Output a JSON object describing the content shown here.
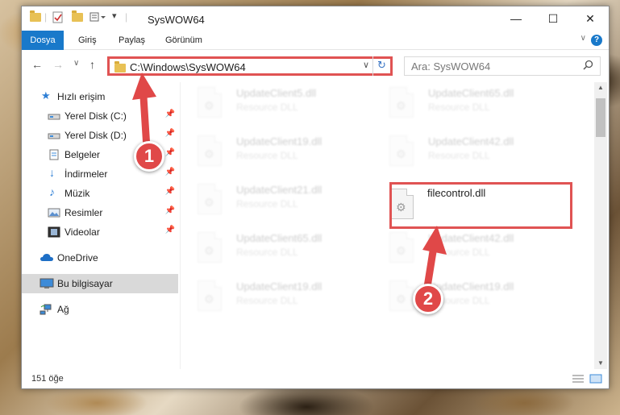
{
  "window": {
    "title": "SysWOW64",
    "minimize": "—",
    "maximize": "☐",
    "close": "✕"
  },
  "ribbon": {
    "tabs": [
      "Dosya",
      "Giriş",
      "Paylaş",
      "Görünüm"
    ],
    "help": "?"
  },
  "address": {
    "path": "C:\\Windows\\SysWOW64",
    "search_placeholder": "Ara: SysWOW64"
  },
  "sidebar": {
    "items": [
      {
        "label": "Hızlı erişim",
        "icon": "star-icon"
      },
      {
        "label": "Yerel Disk (C:)",
        "icon": "drive-icon",
        "pinned": true
      },
      {
        "label": "Yerel Disk (D:)",
        "icon": "drive-icon",
        "pinned": true
      },
      {
        "label": "Belgeler",
        "icon": "documents-icon",
        "pinned": true
      },
      {
        "label": "İndirmeler",
        "icon": "download-icon",
        "pinned": true
      },
      {
        "label": "Müzik",
        "icon": "music-icon",
        "pinned": true
      },
      {
        "label": "Resimler",
        "icon": "pictures-icon",
        "pinned": true
      },
      {
        "label": "Videolar",
        "icon": "videos-icon",
        "pinned": true
      },
      {
        "label": "OneDrive",
        "icon": "cloud-icon"
      },
      {
        "label": "Bu bilgisayar",
        "icon": "computer-icon",
        "selected": true
      },
      {
        "label": "Ağ",
        "icon": "network-icon"
      }
    ]
  },
  "files": [
    {
      "name": "UpdateClient5.dll",
      "type": "Resource DLL",
      "blurred": true
    },
    {
      "name": "UpdateClient65.dll",
      "type": "Resource DLL",
      "blurred": true
    },
    {
      "name": "UpdateClient19.dll",
      "type": "Resource DLL",
      "blurred": true
    },
    {
      "name": "UpdateClient42.dll",
      "type": "Resource DLL",
      "blurred": true
    },
    {
      "name": "UpdateClient21.dll",
      "type": "Resource DLL",
      "blurred": true
    },
    {
      "name": "filecontrol.dll",
      "type": "",
      "blurred": false
    },
    {
      "name": "UpdateClient65.dll",
      "type": "Resource DLL",
      "blurred": true
    },
    {
      "name": "UpdateClient42.dll",
      "type": "Resource DLL",
      "blurred": true
    },
    {
      "name": "UpdateClient19.dll",
      "type": "Resource DLL",
      "blurred": true
    },
    {
      "name": "UpdateClient19.dll",
      "type": "Resource DLL",
      "blurred": true
    }
  ],
  "status": {
    "item_count": "151 öğe"
  },
  "annotations": {
    "step1": "1",
    "step2": "2",
    "accent": "#e05353"
  }
}
